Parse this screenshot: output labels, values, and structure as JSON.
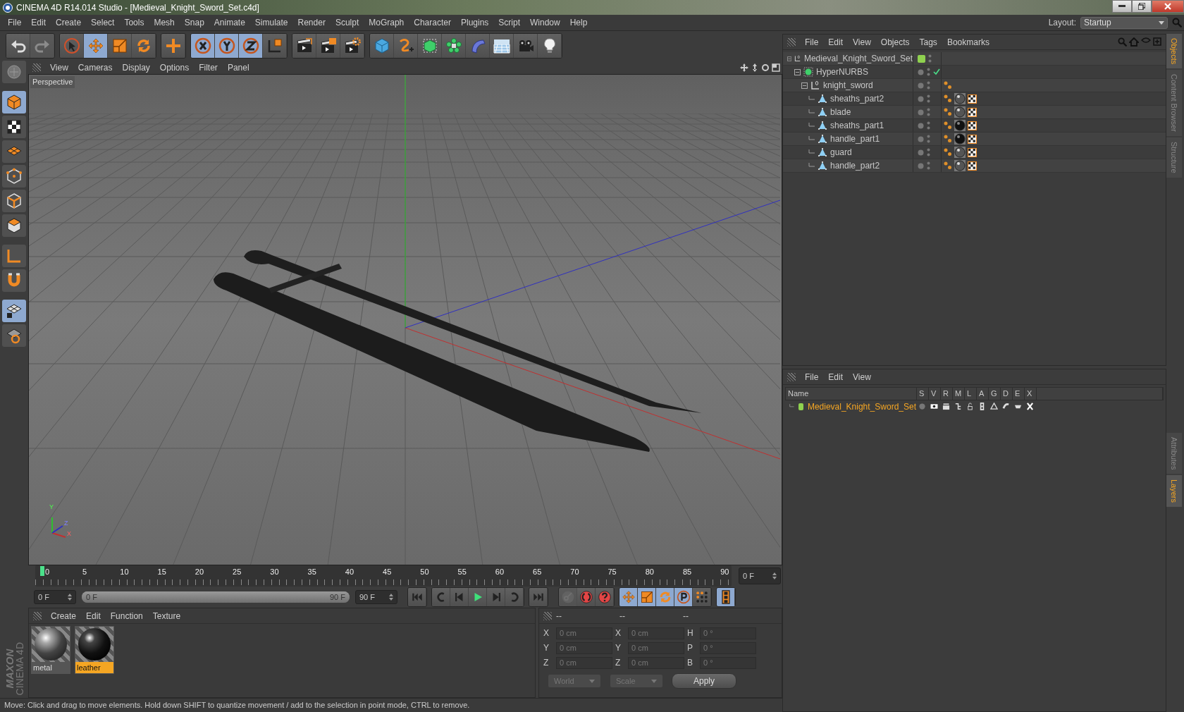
{
  "window": {
    "title": "CINEMA 4D R14.014 Studio - [Medieval_Knight_Sword_Set.c4d]"
  },
  "menu": [
    "File",
    "Edit",
    "Create",
    "Select",
    "Tools",
    "Mesh",
    "Snap",
    "Animate",
    "Simulate",
    "Render",
    "Sculpt",
    "MoGraph",
    "Character",
    "Plugins",
    "Script",
    "Window",
    "Help"
  ],
  "layout": {
    "label": "Layout:",
    "value": "Startup"
  },
  "toolbar": [
    [
      {
        "kind": "undo",
        "selected": false,
        "disabled": false
      },
      {
        "kind": "redo",
        "selected": false,
        "disabled": true
      }
    ],
    [
      {
        "kind": "select",
        "selected": false,
        "disabled": false
      },
      {
        "kind": "move",
        "selected": true,
        "disabled": false
      },
      {
        "kind": "scale",
        "selected": false,
        "disabled": false
      },
      {
        "kind": "rotate",
        "selected": false,
        "disabled": false
      }
    ],
    [
      {
        "kind": "live",
        "selected": false,
        "disabled": false
      }
    ],
    [
      {
        "kind": "x",
        "selected": true,
        "disabled": false
      },
      {
        "kind": "y",
        "selected": true,
        "disabled": false
      },
      {
        "kind": "z",
        "selected": true,
        "disabled": false
      },
      {
        "kind": "coords",
        "selected": false,
        "disabled": false
      }
    ],
    [
      {
        "kind": "renderview",
        "selected": false,
        "disabled": false
      },
      {
        "kind": "render",
        "selected": false,
        "disabled": false
      },
      {
        "kind": "rendersettings",
        "selected": false,
        "disabled": false
      }
    ],
    [
      {
        "kind": "cube",
        "selected": false,
        "disabled": false
      },
      {
        "kind": "spline",
        "selected": false,
        "disabled": false
      },
      {
        "kind": "nurbs",
        "selected": false,
        "disabled": false
      },
      {
        "kind": "array",
        "selected": false,
        "disabled": false
      },
      {
        "kind": "deformer",
        "selected": false,
        "disabled": false
      },
      {
        "kind": "floor",
        "selected": false,
        "disabled": false
      },
      {
        "kind": "camera",
        "selected": false,
        "disabled": false
      },
      {
        "kind": "light",
        "selected": false,
        "disabled": false
      }
    ]
  ],
  "left_tools": [
    {
      "kind": "editable",
      "selected": false
    },
    {
      "kind": "model",
      "selected": true
    },
    {
      "kind": "texture",
      "selected": false
    },
    {
      "kind": "workplane",
      "selected": false
    },
    {
      "kind": "points",
      "selected": false
    },
    {
      "kind": "edges",
      "selected": false
    },
    {
      "kind": "polygons",
      "selected": false
    },
    {
      "kind": "axis",
      "selected": false
    },
    {
      "kind": "magnet",
      "selected": false
    },
    {
      "kind": "lockplane",
      "selected": true
    },
    {
      "kind": "quantize",
      "selected": false
    }
  ],
  "viewport": {
    "menu": [
      "View",
      "Cameras",
      "Display",
      "Options",
      "Filter",
      "Panel"
    ],
    "label": "Perspective",
    "axis_labels": [
      "Y",
      "Z",
      "X"
    ]
  },
  "timeline": {
    "ticks": [
      "0",
      "5",
      "10",
      "15",
      "20",
      "25",
      "30",
      "35",
      "40",
      "45",
      "50",
      "55",
      "60",
      "65",
      "70",
      "75",
      "80",
      "85",
      "90"
    ],
    "level": 0,
    "current": "0 F",
    "start": "0 F",
    "range": {
      "start": "0 F",
      "end": "90 F",
      "level": 1
    },
    "end": "90 F"
  },
  "playback": [
    [
      {
        "kind": "first"
      }
    ],
    [
      {
        "kind": "prevkey"
      },
      {
        "kind": "prev"
      },
      {
        "kind": "play"
      },
      {
        "kind": "next"
      },
      {
        "kind": "nextkey"
      }
    ],
    [
      {
        "kind": "last"
      }
    ]
  ],
  "keys": [
    [
      {
        "kind": "record",
        "selected": false,
        "disabled": true
      },
      {
        "kind": "autokey",
        "selected": false,
        "disabled": false
      },
      {
        "kind": "keyhelp",
        "selected": false,
        "disabled": false
      }
    ],
    [
      {
        "kind": "move",
        "selected": true,
        "disabled": false
      },
      {
        "kind": "scale",
        "selected": true,
        "disabled": false
      },
      {
        "kind": "rotate",
        "selected": true,
        "disabled": false
      },
      {
        "kind": "param",
        "selected": true,
        "disabled": false
      },
      {
        "kind": "pla",
        "selected": false,
        "disabled": false
      }
    ],
    [
      {
        "kind": "film",
        "selected": true,
        "disabled": false
      }
    ]
  ],
  "materials": {
    "menu": [
      "Create",
      "Edit",
      "Function",
      "Texture"
    ],
    "items": [
      {
        "name": "metal",
        "kind": "metal",
        "selected": false
      },
      {
        "name": "leather",
        "kind": "leather",
        "selected": true
      }
    ]
  },
  "logo": {
    "brand": "MAXON",
    "product": "CINEMA 4D"
  },
  "coordinates": {
    "headers": [
      "--",
      "--",
      "--"
    ],
    "rows": [
      [
        {
          "label": "X",
          "value": "0 cm"
        },
        {
          "label": "X",
          "value": "0 cm"
        },
        {
          "label": "H",
          "value": "0 °"
        }
      ],
      [
        {
          "label": "Y",
          "value": "0 cm"
        },
        {
          "label": "Y",
          "value": "0 cm"
        },
        {
          "label": "P",
          "value": "0 °"
        }
      ],
      [
        {
          "label": "Z",
          "value": "0 cm"
        },
        {
          "label": "Z",
          "value": "0 cm"
        },
        {
          "label": "B",
          "value": "0 °"
        }
      ]
    ],
    "dropdowns": [
      "World",
      "Scale"
    ],
    "apply": "Apply"
  },
  "status_bar": "Move: Click and drag to move elements. Hold down SHIFT to quantize movement / add to the selection in point mode, CTRL to remove.",
  "objects": {
    "menu": [
      "File",
      "Edit",
      "View",
      "Objects",
      "Tags",
      "Bookmarks"
    ],
    "tree": [
      {
        "name": "Medieval_Knight_Sword_Set",
        "kind": "null",
        "expanded": true,
        "color": "#8fd14f",
        "children": [
          {
            "name": "HyperNURBS",
            "kind": "hypernurbs",
            "expanded": true,
            "children": [
              {
                "name": "knight_sword",
                "kind": "null",
                "expanded": true,
                "children": [
                  {
                    "name": "sheaths_part2",
                    "kind": "polygon",
                    "dark_material": false
                  },
                  {
                    "name": "blade",
                    "kind": "polygon",
                    "dark_material": false
                  },
                  {
                    "name": "sheaths_part1",
                    "kind": "polygon",
                    "dark_material": true
                  },
                  {
                    "name": "handle_part1",
                    "kind": "polygon",
                    "dark_material": true
                  },
                  {
                    "name": "guard",
                    "kind": "polygon",
                    "dark_material": false
                  },
                  {
                    "name": "handle_part2",
                    "kind": "polygon",
                    "dark_material": false
                  }
                ]
              }
            ]
          }
        ]
      }
    ]
  },
  "layers": {
    "menu": [
      "File",
      "Edit",
      "View"
    ],
    "columns": [
      "Name",
      "S",
      "V",
      "R",
      "M",
      "L",
      "A",
      "G",
      "D",
      "E",
      "X"
    ],
    "rows": [
      {
        "name": "Medieval_Knight_Sword_Set",
        "color": "#8fd14f"
      }
    ]
  },
  "side_tabs": [
    {
      "label": "Objects",
      "selected": true
    },
    {
      "label": "Content Browser",
      "selected": false
    },
    {
      "label": "Structure",
      "selected": false
    },
    {
      "label": "Attributes",
      "selected": false
    },
    {
      "label": "Layers",
      "selected": true
    }
  ]
}
